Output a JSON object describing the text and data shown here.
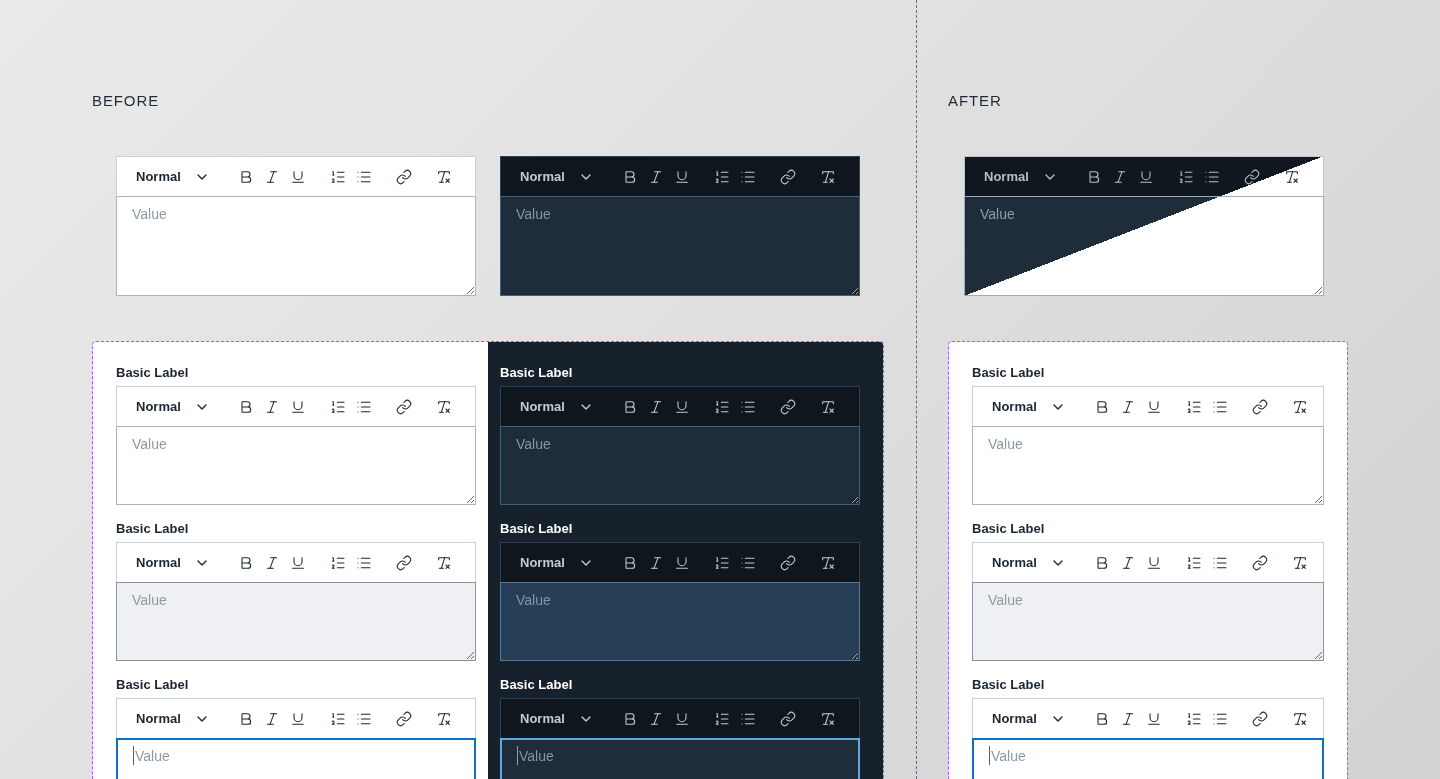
{
  "sections": [
    {
      "title": "BEFORE",
      "samples": [
        {
          "kind": "light",
          "format": "Normal",
          "placeholder": "Value"
        },
        {
          "kind": "dark",
          "format": "Normal",
          "placeholder": "Value"
        }
      ],
      "panel": {
        "columns": [
          {
            "kind": "light",
            "fields": [
              {
                "label": "Basic Label",
                "format": "Normal",
                "placeholder": "Value",
                "disabled": false,
                "focused": false
              },
              {
                "label": "Basic Label",
                "format": "Normal",
                "placeholder": "Value",
                "disabled": true,
                "focused": false
              },
              {
                "label": "Basic Label",
                "format": "Normal",
                "placeholder": "Value",
                "disabled": false,
                "focused": true
              }
            ]
          },
          {
            "kind": "dark",
            "fields": [
              {
                "label": "Basic Label",
                "format": "Normal",
                "placeholder": "Value",
                "disabled": false,
                "focused": false
              },
              {
                "label": "Basic Label",
                "format": "Normal",
                "placeholder": "Value",
                "disabled": true,
                "focused": false
              },
              {
                "label": "Basic Label",
                "format": "Normal",
                "placeholder": "Value",
                "disabled": false,
                "focused": true
              }
            ]
          }
        ]
      }
    },
    {
      "title": "AFTER",
      "samples": [
        {
          "kind": "split",
          "format": "Normal",
          "placeholder": "Value"
        }
      ],
      "panel": {
        "columns": [
          {
            "kind": "light",
            "fields": [
              {
                "label": "Basic Label",
                "format": "Normal",
                "placeholder": "Value",
                "disabled": false,
                "focused": false
              },
              {
                "label": "Basic Label",
                "format": "Normal",
                "placeholder": "Value",
                "disabled": true,
                "focused": false
              },
              {
                "label": "Basic Label",
                "format": "Normal",
                "placeholder": "Value",
                "disabled": false,
                "focused": true
              }
            ]
          }
        ]
      }
    }
  ]
}
